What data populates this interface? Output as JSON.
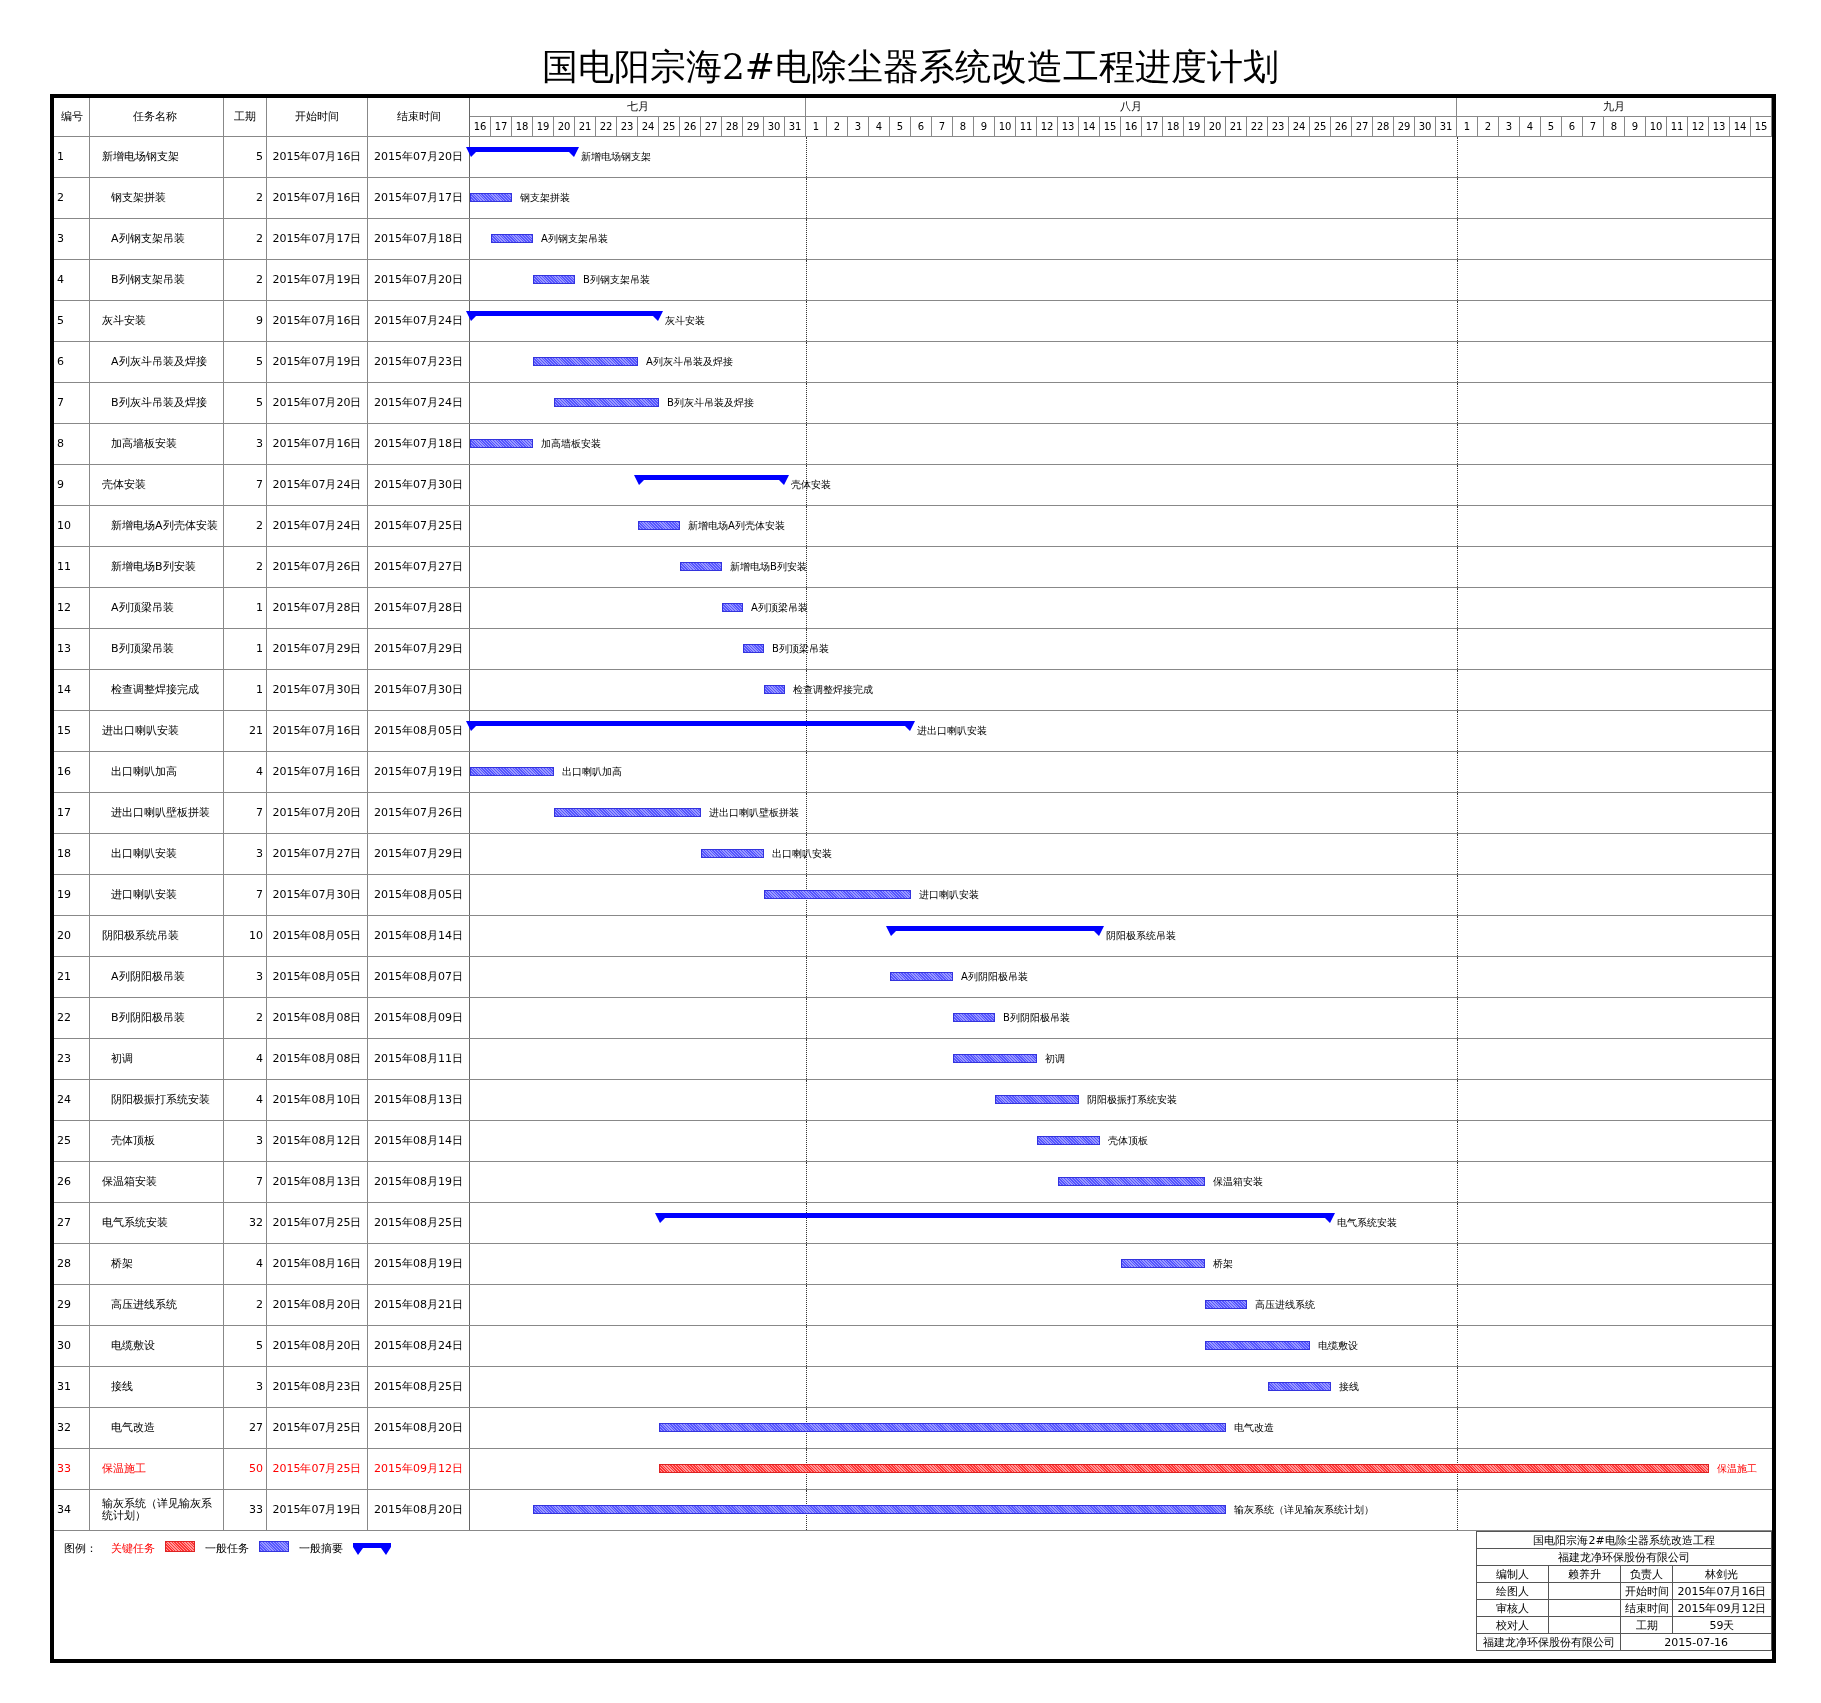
{
  "title": "国电阳宗海2#电除尘器系统改造工程进度计划",
  "columns": [
    "编号",
    "任务名称",
    "工期",
    "开始时间",
    "结束时间"
  ],
  "timeline": {
    "months": [
      {
        "label": "七月",
        "days": [
          "16",
          "17",
          "18",
          "19",
          "20",
          "21",
          "22",
          "23",
          "24",
          "25",
          "26",
          "27",
          "28",
          "29",
          "30",
          "31"
        ]
      },
      {
        "label": "八月",
        "days": [
          "1",
          "2",
          "3",
          "4",
          "5",
          "6",
          "7",
          "8",
          "9",
          "10",
          "11",
          "12",
          "13",
          "14",
          "15",
          "16",
          "17",
          "18",
          "19",
          "20",
          "21",
          "22",
          "23",
          "24",
          "25",
          "26",
          "27",
          "28",
          "29",
          "30",
          "31"
        ]
      },
      {
        "label": "九月",
        "days": [
          "1",
          "2",
          "3",
          "4",
          "5",
          "6",
          "7",
          "8",
          "9",
          "10",
          "11",
          "12",
          "13",
          "14",
          "15"
        ]
      }
    ]
  },
  "tasks": [
    {
      "id": "1",
      "name": "新增电场钢支架",
      "duration": "5",
      "start": "2015年07月16日",
      "end": "2015年07月20日",
      "kind": "summary",
      "bar_label": "新增电场钢支架",
      "children": [
        {
          "id": "2",
          "name": "钢支架拼装",
          "duration": "2",
          "start": "2015年07月16日",
          "end": "2015年07月17日",
          "kind": "task",
          "bar_label": "钢支架拼装"
        },
        {
          "id": "3",
          "name": "A列钢支架吊装",
          "duration": "2",
          "start": "2015年07月17日",
          "end": "2015年07月18日",
          "kind": "task",
          "bar_label": "A列钢支架吊装"
        },
        {
          "id": "4",
          "name": "B列钢支架吊装",
          "duration": "2",
          "start": "2015年07月19日",
          "end": "2015年07月20日",
          "kind": "task",
          "bar_label": "B列钢支架吊装"
        }
      ]
    },
    {
      "id": "5",
      "name": "灰斗安装",
      "duration": "9",
      "start": "2015年07月16日",
      "end": "2015年07月24日",
      "kind": "summary",
      "bar_label": "灰斗安装",
      "children": [
        {
          "id": "6",
          "name": "A列灰斗吊装及焊接",
          "duration": "5",
          "start": "2015年07月19日",
          "end": "2015年07月23日",
          "kind": "task",
          "bar_label": "A列灰斗吊装及焊接"
        },
        {
          "id": "7",
          "name": "B列灰斗吊装及焊接",
          "duration": "5",
          "start": "2015年07月20日",
          "end": "2015年07月24日",
          "kind": "task",
          "bar_label": "B列灰斗吊装及焊接"
        },
        {
          "id": "8",
          "name": "加高墙板安装",
          "duration": "3",
          "start": "2015年07月16日",
          "end": "2015年07月18日",
          "kind": "task",
          "bar_label": "加高墙板安装"
        }
      ]
    },
    {
      "id": "9",
      "name": "壳体安装",
      "duration": "7",
      "start": "2015年07月24日",
      "end": "2015年07月30日",
      "kind": "summary",
      "bar_label": "壳体安装",
      "children": [
        {
          "id": "10",
          "name": "新增电场A列壳体安装",
          "duration": "2",
          "start": "2015年07月24日",
          "end": "2015年07月25日",
          "kind": "task",
          "bar_label": "新增电场A列壳体安装"
        },
        {
          "id": "11",
          "name": "新增电场B列安装",
          "duration": "2",
          "start": "2015年07月26日",
          "end": "2015年07月27日",
          "kind": "task",
          "bar_label": "新增电场B列安装"
        },
        {
          "id": "12",
          "name": "A列顶梁吊装",
          "duration": "1",
          "start": "2015年07月28日",
          "end": "2015年07月28日",
          "kind": "task",
          "bar_label": "A列顶梁吊装"
        },
        {
          "id": "13",
          "name": "B列顶梁吊装",
          "duration": "1",
          "start": "2015年07月29日",
          "end": "2015年07月29日",
          "kind": "task",
          "bar_label": "B列顶梁吊装"
        },
        {
          "id": "14",
          "name": "检查调整焊接完成",
          "duration": "1",
          "start": "2015年07月30日",
          "end": "2015年07月30日",
          "kind": "task",
          "bar_label": "检查调整焊接完成"
        }
      ]
    },
    {
      "id": "15",
      "name": "进出口喇叭安装",
      "duration": "21",
      "start": "2015年07月16日",
      "end": "2015年08月05日",
      "kind": "summary",
      "bar_label": "进出口喇叭安装",
      "children": [
        {
          "id": "16",
          "name": "出口喇叭加高",
          "duration": "4",
          "start": "2015年07月16日",
          "end": "2015年07月19日",
          "kind": "task",
          "bar_label": "出口喇叭加高"
        },
        {
          "id": "17",
          "name": "进出口喇叭壁板拼装",
          "duration": "7",
          "start": "2015年07月20日",
          "end": "2015年07月26日",
          "kind": "task",
          "bar_label": "进出口喇叭壁板拼装"
        },
        {
          "id": "18",
          "name": "出口喇叭安装",
          "duration": "3",
          "start": "2015年07月27日",
          "end": "2015年07月29日",
          "kind": "task",
          "bar_label": "出口喇叭安装"
        },
        {
          "id": "19",
          "name": "进口喇叭安装",
          "duration": "7",
          "start": "2015年07月30日",
          "end": "2015年08月05日",
          "kind": "task",
          "bar_label": "进口喇叭安装"
        }
      ]
    },
    {
      "id": "20",
      "name": "阴阳极系统吊装",
      "duration": "10",
      "start": "2015年08月05日",
      "end": "2015年08月14日",
      "kind": "summary",
      "bar_label": "阴阳极系统吊装",
      "children": [
        {
          "id": "21",
          "name": "A列阴阳极吊装",
          "duration": "3",
          "start": "2015年08月05日",
          "end": "2015年08月07日",
          "kind": "task",
          "bar_label": "A列阴阳极吊装"
        },
        {
          "id": "22",
          "name": "B列阴阳极吊装",
          "duration": "2",
          "start": "2015年08月08日",
          "end": "2015年08月09日",
          "kind": "task",
          "bar_label": "B列阴阳极吊装"
        },
        {
          "id": "23",
          "name": "初调",
          "duration": "4",
          "start": "2015年08月08日",
          "end": "2015年08月11日",
          "kind": "task",
          "bar_label": "初调"
        },
        {
          "id": "24",
          "name": "阴阳极振打系统安装",
          "duration": "4",
          "start": "2015年08月10日",
          "end": "2015年08月13日",
          "kind": "task",
          "bar_label": "阴阳极振打系统安装"
        },
        {
          "id": "25",
          "name": "壳体顶板",
          "duration": "3",
          "start": "2015年08月12日",
          "end": "2015年08月14日",
          "kind": "task",
          "bar_label": "壳体顶板"
        }
      ]
    },
    {
      "id": "26",
      "name": "保温箱安装",
      "duration": "7",
      "start": "2015年08月13日",
      "end": "2015年08月19日",
      "kind": "task",
      "bar_label": "保温箱安装"
    },
    {
      "id": "27",
      "name": "电气系统安装",
      "duration": "32",
      "start": "2015年07月25日",
      "end": "2015年08月25日",
      "kind": "summary",
      "bar_label": "电气系统安装",
      "children": [
        {
          "id": "28",
          "name": "桥架",
          "duration": "4",
          "start": "2015年08月16日",
          "end": "2015年08月19日",
          "kind": "task",
          "bar_label": "桥架"
        },
        {
          "id": "29",
          "name": "高压进线系统",
          "duration": "2",
          "start": "2015年08月20日",
          "end": "2015年08月21日",
          "kind": "task",
          "bar_label": "高压进线系统"
        },
        {
          "id": "30",
          "name": "电缆敷设",
          "duration": "5",
          "start": "2015年08月20日",
          "end": "2015年08月24日",
          "kind": "task",
          "bar_label": "电缆敷设"
        },
        {
          "id": "31",
          "name": "接线",
          "duration": "3",
          "start": "2015年08月23日",
          "end": "2015年08月25日",
          "kind": "task",
          "bar_label": "接线"
        },
        {
          "id": "32",
          "name": "电气改造",
          "duration": "27",
          "start": "2015年07月25日",
          "end": "2015年08月20日",
          "kind": "task",
          "bar_label": "电气改造"
        }
      ]
    },
    {
      "id": "33",
      "name": "保温施工",
      "duration": "50",
      "start": "2015年07月25日",
      "end": "2015年09月12日",
      "kind": "critical",
      "bar_label": "保温施工"
    },
    {
      "id": "34",
      "name": "输灰系统（详见输灰系统计划）",
      "duration": "33",
      "start": "2015年07月19日",
      "end": "2015年08月20日",
      "kind": "task",
      "bar_label": "输灰系统（详见输灰系统计划）"
    }
  ],
  "legend": {
    "label": "图例：",
    "items": [
      {
        "label": "关键任务",
        "kind": "critical"
      },
      {
        "label": "一般任务",
        "kind": "task"
      },
      {
        "label": "一般摘要",
        "kind": "summary"
      }
    ]
  },
  "info_box": {
    "project": "国电阳宗海2#电除尘器系统改造工程",
    "company": "福建龙净环保股份有限公司",
    "rows": [
      {
        "label": "编制人",
        "value": "赖养升",
        "right_label": "负责人",
        "right_value": "林剑光"
      },
      {
        "label": "绘图人",
        "right_label": "开始时间",
        "right_value": "2015年07月16日"
      },
      {
        "label": "审核人",
        "right_label": "结束时间",
        "right_value": "2015年09月12日"
      },
      {
        "label": "校对人",
        "right_label": "工期",
        "right_value": "59天"
      }
    ],
    "footer_company": "福建龙净环保股份有限公司",
    "footer_date": "2015-07-16"
  }
}
